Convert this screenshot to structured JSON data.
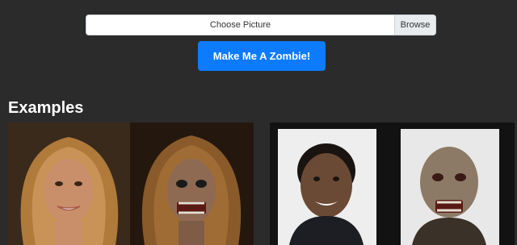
{
  "upload": {
    "placeholder": "Choose Picture",
    "browse_label": "Browse"
  },
  "cta": {
    "label": "Make Me A Zombie!"
  },
  "examples": {
    "title": "Examples",
    "items": [
      {
        "before": "woman-portrait",
        "after": "woman-zombie-portrait"
      },
      {
        "before": "man-portrait",
        "after": "man-zombie-portrait"
      }
    ]
  },
  "colors": {
    "background": "#2b2b2b",
    "accent": "#0d7bff"
  }
}
